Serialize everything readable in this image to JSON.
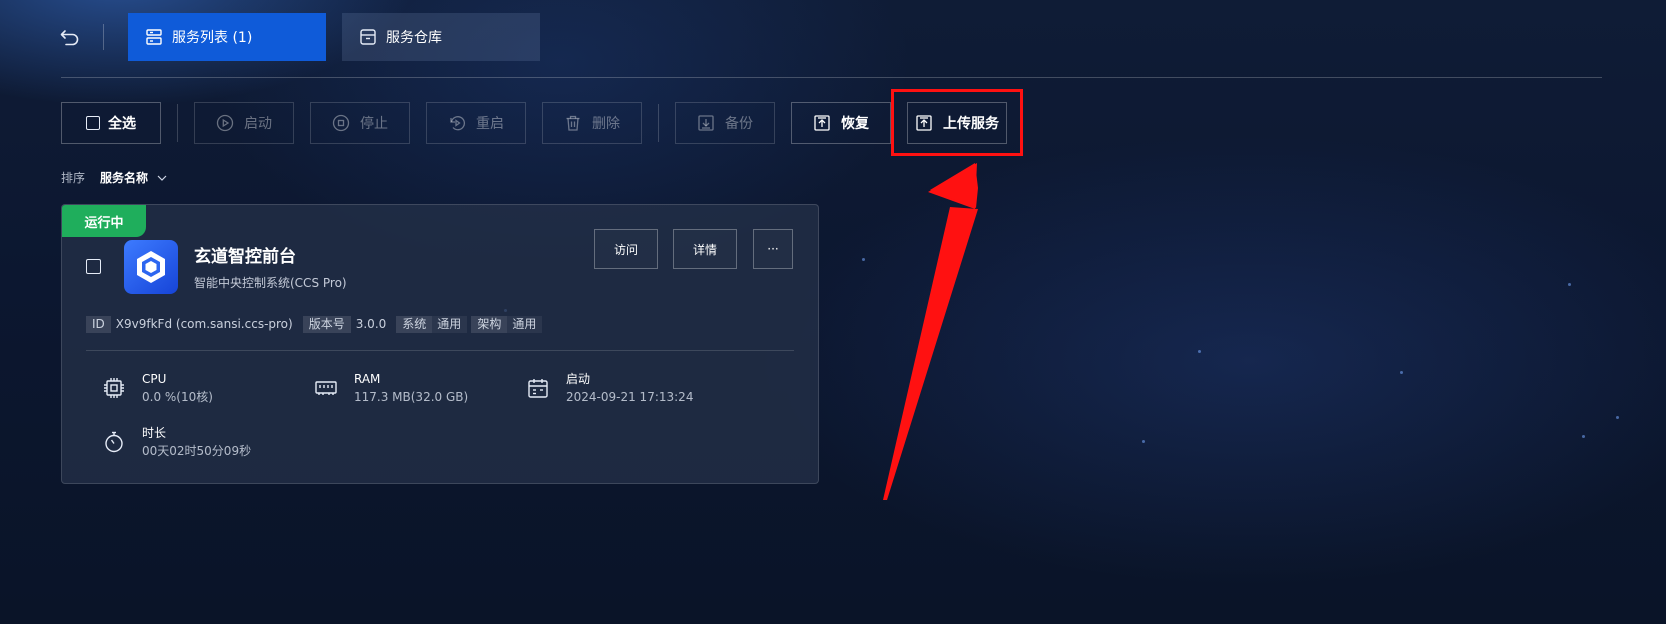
{
  "header": {
    "tabs": [
      {
        "label": "服务列表 (1)",
        "icon": "server-list-icon",
        "active": true
      },
      {
        "label": "服务仓库",
        "icon": "archive-box-icon",
        "active": false
      }
    ],
    "back_icon": "undo-arrow-icon"
  },
  "toolbar": {
    "select_all": "全选",
    "start": "启动",
    "stop": "停止",
    "restart": "重启",
    "delete": "删除",
    "backup": "备份",
    "restore": "恢复",
    "upload": "上传服务"
  },
  "sort": {
    "label": "排序",
    "value": "服务名称"
  },
  "service": {
    "status": "运行中",
    "name": "玄道智控前台",
    "description": "智能中央控制系统(CCS Pro)",
    "actions": {
      "visit": "访问",
      "details": "详情",
      "more": "···"
    },
    "tags": [
      {
        "key": "ID",
        "value": "X9v9fkFd (com.sansi.ccs-pro)"
      },
      {
        "key": "版本号",
        "value": "3.0.0"
      },
      {
        "key": "系统",
        "value": "通用"
      },
      {
        "key": "架构",
        "value": "通用"
      }
    ],
    "metrics": {
      "cpu": {
        "label": "CPU",
        "value": "0.0 %(10核)"
      },
      "ram": {
        "label": "RAM",
        "value": "117.3 MB(32.0 GB)"
      },
      "start": {
        "label": "启动",
        "value": "2024-09-21 17:13:24"
      },
      "duration": {
        "label": "时长",
        "value": "00天02时50分09秒"
      }
    }
  },
  "colors": {
    "active_tab": "#0f5bd9",
    "status_running": "#1fae5c",
    "highlight": "#ff1111",
    "background": "#0c1730"
  }
}
